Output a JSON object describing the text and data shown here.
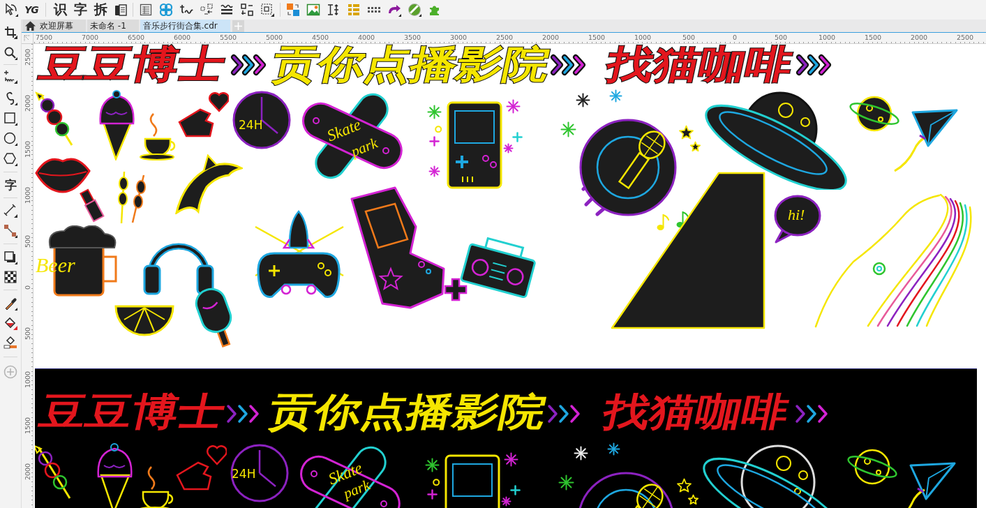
{
  "toolbar": {
    "text_buttons": [
      "YG",
      "识",
      "字",
      "拆"
    ]
  },
  "toolbox": {
    "text_tool": "字"
  },
  "tabs": [
    {
      "label": "欢迎屏幕",
      "kind": "home",
      "selected": false
    },
    {
      "label": "未命名 -1",
      "kind": "document",
      "selected": false
    },
    {
      "label": "音乐步行街合集.cdr",
      "kind": "document",
      "selected": true
    }
  ],
  "rulers": {
    "horizontal": [
      "7500",
      "7000",
      "6500",
      "6000",
      "5500",
      "5000",
      "4500",
      "4000",
      "3500",
      "3000",
      "2500",
      "2000",
      "1500",
      "1000",
      "500",
      "0",
      "500",
      "1000",
      "1500",
      "2000",
      "2500"
    ],
    "vertical": [
      "2500",
      "2000",
      "1500",
      "1000",
      "500",
      "0",
      "500",
      "1000",
      "1500",
      "2000"
    ]
  },
  "artboards": [
    {
      "kind": "light",
      "signs": [
        {
          "text": "豆豆博士",
          "color": "#e3161d"
        },
        {
          "text": "贡你点播影院",
          "color": "#f5e600"
        },
        {
          "text": "找猫咖啡",
          "color": "#e3161d"
        }
      ],
      "clock_label": "24H",
      "skate_label": [
        "Skate",
        "park"
      ],
      "beer_label": "Beer",
      "bubble_label": "hi!"
    },
    {
      "kind": "dark",
      "signs": [
        {
          "text": "豆豆博士",
          "color": "#e3161d"
        },
        {
          "text": "贡你点播影院",
          "color": "#f5e600"
        },
        {
          "text": "找猫咖啡",
          "color": "#e3161d"
        }
      ],
      "clock_label": "24H",
      "skate_label": [
        "Skate",
        "park"
      ]
    }
  ]
}
